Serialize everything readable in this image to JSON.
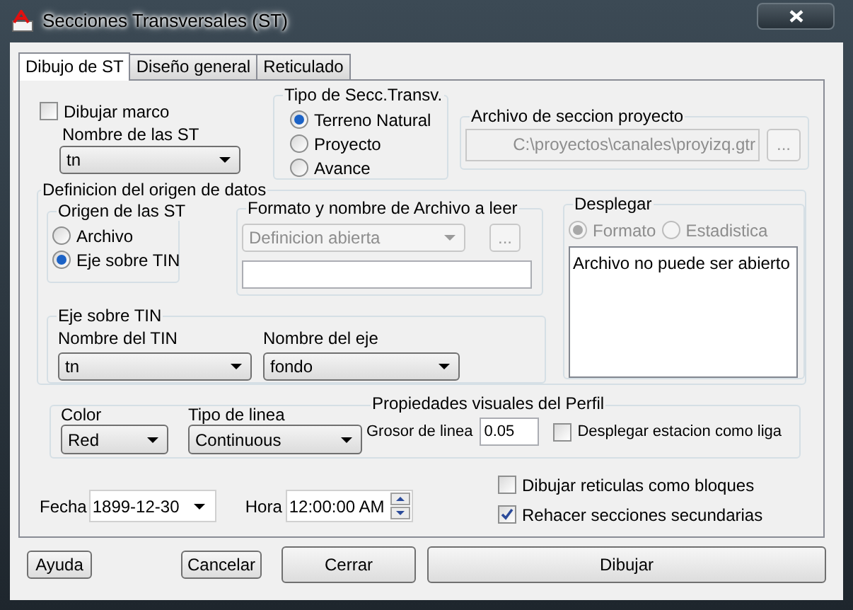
{
  "window": {
    "title": "Secciones Transversales (ST)"
  },
  "tabs": [
    {
      "label": "Dibujo de ST",
      "selected": true
    },
    {
      "label": "Diseño general",
      "selected": false
    },
    {
      "label": "Reticulado",
      "selected": false
    }
  ],
  "dibujar_marco": {
    "label": "Dibujar marco",
    "checked": false
  },
  "nombre_st": {
    "label": "Nombre de las ST",
    "value": "tn"
  },
  "tipo_secc": {
    "title": "Tipo de Secc.Transv.",
    "options": [
      {
        "label": "Terreno Natural",
        "selected": true
      },
      {
        "label": "Proyecto",
        "selected": false
      },
      {
        "label": "Avance",
        "selected": false
      }
    ]
  },
  "archivo_proyecto": {
    "title": "Archivo de seccion proyecto",
    "value": "C:\\proyectos\\canales\\proyizq.gtr",
    "disabled": true,
    "browse": "..."
  },
  "origen_datos": {
    "title": "Definicion del origen de datos",
    "origen_st": {
      "title": "Origen de las ST",
      "options": [
        {
          "label": "Archivo",
          "selected": false
        },
        {
          "label": "Eje sobre TIN",
          "selected": true
        }
      ]
    },
    "formato": {
      "title": "Formato y nombre de Archivo a leer",
      "format": "Definicion abierta",
      "disabled": true,
      "browse": "..."
    },
    "eje_tin": {
      "title": "Eje sobre TIN",
      "tin_label": "Nombre del TIN",
      "tin": "tn",
      "eje_label": "Nombre del eje",
      "eje": "fondo"
    },
    "desplegar": {
      "title": "Desplegar",
      "options": [
        {
          "label": "Formato",
          "selected": true,
          "disabled": true
        },
        {
          "label": "Estadistica",
          "selected": false,
          "disabled": true
        }
      ],
      "text": "Archivo no puede ser abierto"
    }
  },
  "propiedades": {
    "title": "Propiedades visuales del Perfil",
    "color_label": "Color",
    "line_color": "Red",
    "linea_label": "Tipo de linea",
    "linea": "Continuous",
    "grosor_label": "Grosor de linea",
    "grosor": "0.05",
    "estacion": {
      "label": "Desplegar estacion como liga",
      "checked": false
    }
  },
  "checks": [
    {
      "label": "Dibujar reticulas como bloques",
      "checked": false
    },
    {
      "label": "Rehacer secciones secundarias",
      "checked": true
    }
  ],
  "fecha": {
    "label": "Fecha",
    "value": "1899-12-30"
  },
  "hora": {
    "label": "Hora",
    "value": "12:00:00 AM"
  },
  "buttons": [
    {
      "label": "Ayuda",
      "kind": "small"
    },
    {
      "label": "Cancelar",
      "kind": "small"
    },
    {
      "label": "Cerrar",
      "kind": "medium"
    },
    {
      "label": "Dibujar",
      "kind": "wide"
    }
  ]
}
